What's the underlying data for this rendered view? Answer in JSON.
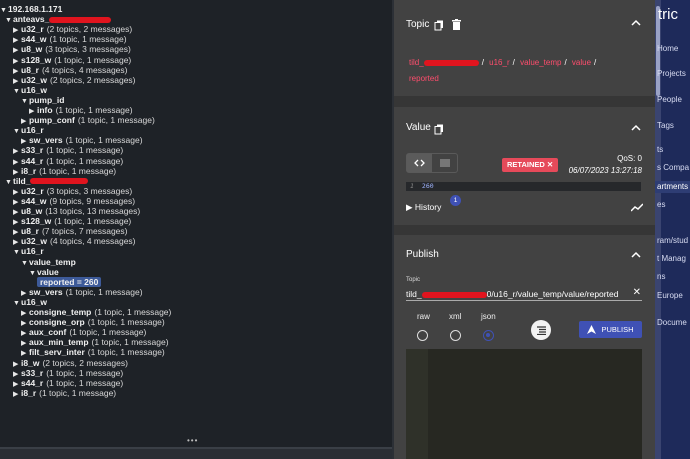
{
  "tree": {
    "rows": [
      {
        "d": 0,
        "arrow": "▼",
        "name": "192.168.1.171",
        "meta": "",
        "redact": 0,
        "sel": false
      },
      {
        "d": 1,
        "arrow": "▼",
        "name": "anteavs_",
        "meta": "",
        "redact": 62,
        "sel": false
      },
      {
        "d": 2,
        "arrow": "▶",
        "name": "u32_r",
        "meta": "(2 topics, 2 messages)",
        "redact": 0,
        "sel": false
      },
      {
        "d": 2,
        "arrow": "▶",
        "name": "s44_w",
        "meta": "(1 topic, 1 message)",
        "redact": 0,
        "sel": false
      },
      {
        "d": 2,
        "arrow": "▶",
        "name": "u8_w",
        "meta": "(3 topics, 3 messages)",
        "redact": 0,
        "sel": false
      },
      {
        "d": 2,
        "arrow": "▶",
        "name": "s128_w",
        "meta": "(1 topic, 1 message)",
        "redact": 0,
        "sel": false
      },
      {
        "d": 2,
        "arrow": "▶",
        "name": "u8_r",
        "meta": "(4 topics, 4 messages)",
        "redact": 0,
        "sel": false
      },
      {
        "d": 2,
        "arrow": "▶",
        "name": "u32_w",
        "meta": "(2 topics, 2 messages)",
        "redact": 0,
        "sel": false
      },
      {
        "d": 2,
        "arrow": "▼",
        "name": "u16_w",
        "meta": "",
        "redact": 0,
        "sel": false
      },
      {
        "d": 3,
        "arrow": "▼",
        "name": "pump_id",
        "meta": "",
        "redact": 0,
        "sel": false
      },
      {
        "d": 4,
        "arrow": "▶",
        "name": "info",
        "meta": "(1 topic, 1 message)",
        "redact": 0,
        "sel": false
      },
      {
        "d": 3,
        "arrow": "▶",
        "name": "pump_conf",
        "meta": "(1 topic, 1 message)",
        "redact": 0,
        "sel": false
      },
      {
        "d": 2,
        "arrow": "▼",
        "name": "u16_r",
        "meta": "",
        "redact": 0,
        "sel": false
      },
      {
        "d": 3,
        "arrow": "▶",
        "name": "sw_vers",
        "meta": "(1 topic, 1 message)",
        "redact": 0,
        "sel": false
      },
      {
        "d": 2,
        "arrow": "▶",
        "name": "s33_r",
        "meta": "(1 topic, 1 message)",
        "redact": 0,
        "sel": false
      },
      {
        "d": 2,
        "arrow": "▶",
        "name": "s44_r",
        "meta": "(1 topic, 1 message)",
        "redact": 0,
        "sel": false
      },
      {
        "d": 2,
        "arrow": "▶",
        "name": "i8_r",
        "meta": "(1 topic, 1 message)",
        "redact": 0,
        "sel": false
      },
      {
        "d": 1,
        "arrow": "▼",
        "name": "tild_",
        "meta": "",
        "redact": 58,
        "sel": false
      },
      {
        "d": 2,
        "arrow": "▶",
        "name": "u32_r",
        "meta": "(3 topics, 3 messages)",
        "redact": 0,
        "sel": false
      },
      {
        "d": 2,
        "arrow": "▶",
        "name": "s44_w",
        "meta": "(9 topics, 9 messages)",
        "redact": 0,
        "sel": false
      },
      {
        "d": 2,
        "arrow": "▶",
        "name": "u8_w",
        "meta": "(13 topics, 13 messages)",
        "redact": 0,
        "sel": false
      },
      {
        "d": 2,
        "arrow": "▶",
        "name": "s128_w",
        "meta": "(1 topic, 1 message)",
        "redact": 0,
        "sel": false
      },
      {
        "d": 2,
        "arrow": "▶",
        "name": "u8_r",
        "meta": "(7 topics, 7 messages)",
        "redact": 0,
        "sel": false
      },
      {
        "d": 2,
        "arrow": "▶",
        "name": "u32_w",
        "meta": "(4 topics, 4 messages)",
        "redact": 0,
        "sel": false
      },
      {
        "d": 2,
        "arrow": "▼",
        "name": "u16_r",
        "meta": "",
        "redact": 0,
        "sel": false
      },
      {
        "d": 3,
        "arrow": "▼",
        "name": "value_temp",
        "meta": "",
        "redact": 0,
        "sel": false
      },
      {
        "d": 4,
        "arrow": "▼",
        "name": "value",
        "meta": "",
        "redact": 0,
        "sel": false
      },
      {
        "d": 5,
        "arrow": "",
        "name": "reported = 260",
        "meta": "",
        "redact": 0,
        "sel": true
      },
      {
        "d": 3,
        "arrow": "▶",
        "name": "sw_vers",
        "meta": "(1 topic, 1 message)",
        "redact": 0,
        "sel": false
      },
      {
        "d": 2,
        "arrow": "▼",
        "name": "u16_w",
        "meta": "",
        "redact": 0,
        "sel": false
      },
      {
        "d": 3,
        "arrow": "▶",
        "name": "consigne_temp",
        "meta": "(1 topic, 1 message)",
        "redact": 0,
        "sel": false
      },
      {
        "d": 3,
        "arrow": "▶",
        "name": "consigne_orp",
        "meta": "(1 topic, 1 message)",
        "redact": 0,
        "sel": false
      },
      {
        "d": 3,
        "arrow": "▶",
        "name": "aux_conf",
        "meta": "(1 topic, 1 message)",
        "redact": 0,
        "sel": false
      },
      {
        "d": 3,
        "arrow": "▶",
        "name": "aux_min_temp",
        "meta": "(1 topic, 1 message)",
        "redact": 0,
        "sel": false
      },
      {
        "d": 3,
        "arrow": "▶",
        "name": "filt_serv_inter",
        "meta": "(1 topic, 1 message)",
        "redact": 0,
        "sel": false
      },
      {
        "d": 2,
        "arrow": "▶",
        "name": "i8_w",
        "meta": "(2 topics, 2 messages)",
        "redact": 0,
        "sel": false
      },
      {
        "d": 2,
        "arrow": "▶",
        "name": "s33_r",
        "meta": "(1 topic, 1 message)",
        "redact": 0,
        "sel": false
      },
      {
        "d": 2,
        "arrow": "▶",
        "name": "s44_r",
        "meta": "(1 topic, 1 message)",
        "redact": 0,
        "sel": false
      },
      {
        "d": 2,
        "arrow": "▶",
        "name": "i8_r",
        "meta": "(1 topic, 1 message)",
        "redact": 0,
        "sel": false
      }
    ],
    "resize_handle": "•••"
  },
  "topic": {
    "heading": "Topic",
    "path": [
      "tild_",
      "u16_r",
      "value_temp",
      "value",
      "reported"
    ]
  },
  "value": {
    "heading": "Value",
    "retained_label": "RETAINED",
    "qos": "QoS: 0",
    "date": "06/07/2023 13:27:18",
    "line_number": "1",
    "payload": "260",
    "history_label": "History",
    "history_count": "1"
  },
  "publish": {
    "heading": "Publish",
    "topic_label": "Topic",
    "topic_value": "tild_",
    "topic_value_tail": "0/u16_r/value_temp/value/reported",
    "formats": [
      "raw",
      "xml",
      "json"
    ],
    "selected_format": "json",
    "publish_label": "PUBLISH"
  },
  "bg_page": {
    "title": "tric",
    "nav": [
      "Home",
      "Projects",
      "People",
      "Tags",
      "ts",
      "s Compa",
      "artments",
      "es",
      "ram/stud",
      "t Manag",
      "ns",
      "Europe",
      "Docume"
    ],
    "active_nav": "artments"
  },
  "colors": {
    "accent": "#3f51b5",
    "topic_path": "#ff4d6d",
    "retained": "#e64a5a",
    "redaction": "#e0141e"
  }
}
